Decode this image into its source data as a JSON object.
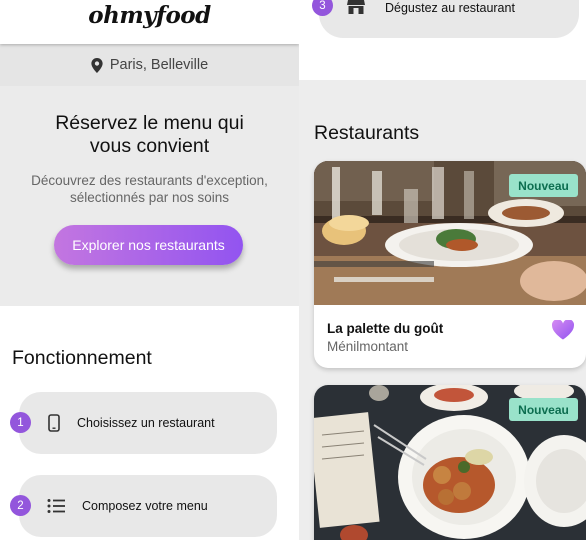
{
  "app": {
    "logo": "ohmyfood"
  },
  "location": {
    "label": "Paris, Belleville",
    "icon": "map-pin-icon"
  },
  "hero": {
    "title_line1": "Réservez le menu qui",
    "title_line2": "vous convient",
    "subtitle_line1": "Découvrez des restaurants d'exception,",
    "subtitle_line2": "sélectionnés par nos soins",
    "cta": "Explorer nos restaurants"
  },
  "how_it_works": {
    "title": "Fonctionnement",
    "steps": [
      {
        "number": "1",
        "label": "Choisissez un restaurant",
        "icon": "smartphone-icon"
      },
      {
        "number": "2",
        "label": "Composez votre menu",
        "icon": "list-icon"
      },
      {
        "number": "3",
        "label": "Dégustez au restaurant",
        "icon": "store-icon"
      }
    ]
  },
  "restaurants": {
    "title": "Restaurants",
    "cards": [
      {
        "name": "La palette du goût",
        "area": "Ménilmontant",
        "badge": "Nouveau",
        "favorite": true
      },
      {
        "name": "",
        "area": "",
        "badge": "Nouveau",
        "favorite": false
      }
    ]
  },
  "colors": {
    "accent_gradient_start": "#c376e0",
    "accent_gradient_end": "#9254f0",
    "badge_bg": "#99e2ca",
    "badge_text": "#0d6e50",
    "step_number_bg": "#9356dc"
  }
}
